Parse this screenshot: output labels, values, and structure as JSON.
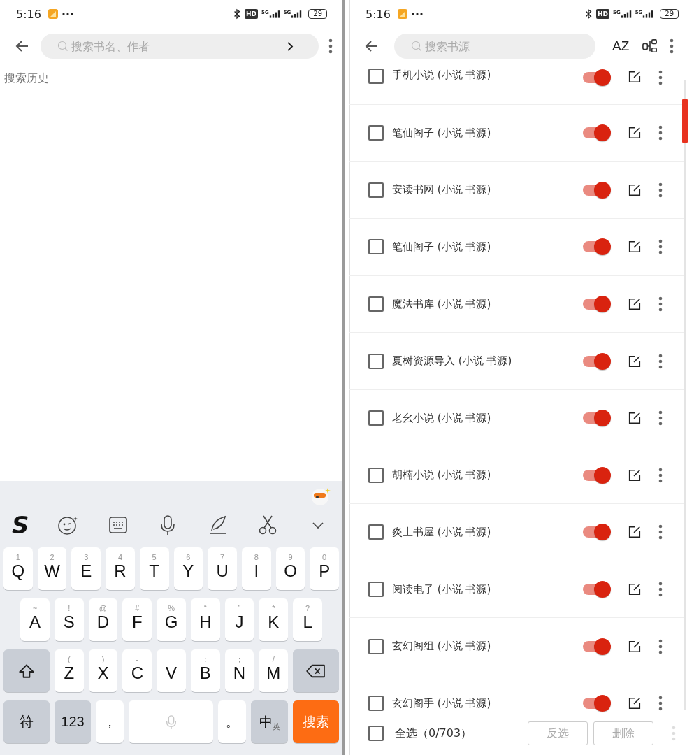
{
  "left": {
    "status_bar": {
      "time": "5:16",
      "hd": "HD",
      "networks": [
        "5G",
        "5G"
      ],
      "battery": "29"
    },
    "search": {
      "placeholder": "搜索书名、作者"
    },
    "history_title": "搜索历史",
    "keyboard": {
      "logo": "S",
      "rows": [
        {
          "keys": [
            {
              "kind": "letter",
              "label": "Q",
              "hint": "1"
            },
            {
              "kind": "letter",
              "label": "W",
              "hint": "2"
            },
            {
              "kind": "letter",
              "label": "E",
              "hint": "3"
            },
            {
              "kind": "letter",
              "label": "R",
              "hint": "4"
            },
            {
              "kind": "letter",
              "label": "T",
              "hint": "5"
            },
            {
              "kind": "letter",
              "label": "Y",
              "hint": "6"
            },
            {
              "kind": "letter",
              "label": "U",
              "hint": "7"
            },
            {
              "kind": "letter",
              "label": "I",
              "hint": "8"
            },
            {
              "kind": "letter",
              "label": "O",
              "hint": "9"
            },
            {
              "kind": "letter",
              "label": "P",
              "hint": "0"
            }
          ]
        },
        {
          "keys": [
            {
              "kind": "letter",
              "label": "A",
              "hint": "~"
            },
            {
              "kind": "letter",
              "label": "S",
              "hint": "!"
            },
            {
              "kind": "letter",
              "label": "D",
              "hint": "@"
            },
            {
              "kind": "letter",
              "label": "F",
              "hint": "#"
            },
            {
              "kind": "letter",
              "label": "G",
              "hint": "%"
            },
            {
              "kind": "letter",
              "label": "H",
              "hint": "“"
            },
            {
              "kind": "letter",
              "label": "J",
              "hint": "”"
            },
            {
              "kind": "letter",
              "label": "K",
              "hint": "*"
            },
            {
              "kind": "letter",
              "label": "L",
              "hint": "?"
            }
          ]
        },
        {
          "keys": [
            {
              "kind": "shift"
            },
            {
              "kind": "letter",
              "label": "Z",
              "hint": "("
            },
            {
              "kind": "letter",
              "label": "X",
              "hint": ")"
            },
            {
              "kind": "letter",
              "label": "C",
              "hint": "-"
            },
            {
              "kind": "letter",
              "label": "V",
              "hint": "_"
            },
            {
              "kind": "letter",
              "label": "B",
              "hint": ":"
            },
            {
              "kind": "letter",
              "label": "N",
              "hint": ";"
            },
            {
              "kind": "letter",
              "label": "M",
              "hint": "/"
            },
            {
              "kind": "backspace"
            }
          ]
        },
        {
          "keys": [
            {
              "kind": "function",
              "label": "符"
            },
            {
              "kind": "function",
              "label": "123"
            },
            {
              "kind": "punct",
              "label": "，"
            },
            {
              "kind": "space"
            },
            {
              "kind": "punct",
              "label": "。"
            },
            {
              "kind": "lang",
              "label": "中",
              "alt": "英"
            },
            {
              "kind": "action",
              "label": "搜索"
            }
          ]
        }
      ]
    }
  },
  "right": {
    "status_bar": {
      "time": "5:16",
      "hd": "HD",
      "networks": [
        "5G",
        "5G"
      ],
      "battery": "29"
    },
    "search": {
      "placeholder": "搜索书源"
    },
    "sort_label": "AZ",
    "sources": [
      {
        "name": "手机小说 (小说 书源)",
        "checked": false,
        "enabled": true
      },
      {
        "name": "笔仙阁子 (小说 书源)",
        "checked": false,
        "enabled": true
      },
      {
        "name": "安读书网 (小说 书源)",
        "checked": false,
        "enabled": true
      },
      {
        "name": "笔仙阁子 (小说 书源)",
        "checked": false,
        "enabled": true
      },
      {
        "name": "魔法书库 (小说 书源)",
        "checked": false,
        "enabled": true
      },
      {
        "name": "夏树资源导入 (小说 书源)",
        "checked": false,
        "enabled": true
      },
      {
        "name": "老幺小说 (小说 书源)",
        "checked": false,
        "enabled": true
      },
      {
        "name": "胡楠小说 (小说 书源)",
        "checked": false,
        "enabled": true
      },
      {
        "name": "炎上书屋 (小说 书源)",
        "checked": false,
        "enabled": true
      },
      {
        "name": "阅读电子 (小说 书源)",
        "checked": false,
        "enabled": true
      },
      {
        "name": "玄幻阁组 (小说 书源)",
        "checked": false,
        "enabled": true
      },
      {
        "name": "玄幻阁手 (小说 书源)",
        "checked": false,
        "enabled": true
      }
    ],
    "footer": {
      "select_all": {
        "label": "全选（0/703）",
        "checked": false
      },
      "buttons": [
        {
          "label": "反选",
          "disabled": true
        },
        {
          "label": "删除",
          "disabled": true
        }
      ]
    }
  }
}
